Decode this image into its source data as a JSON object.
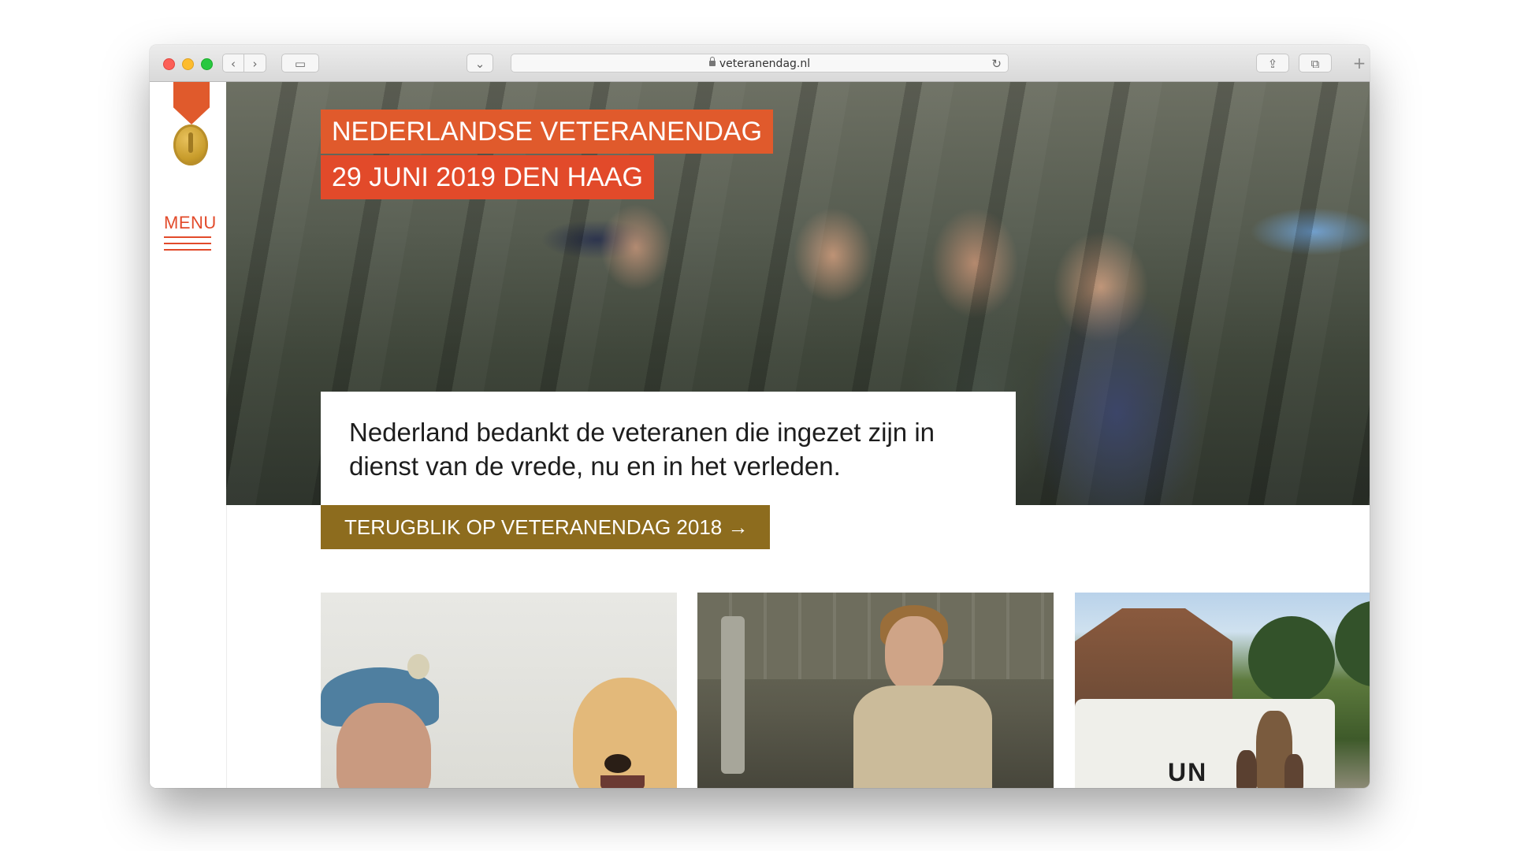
{
  "browser": {
    "url": "veteranendag.nl",
    "traffic_lights": [
      "close",
      "minimize",
      "zoom"
    ],
    "nav_back_icon": "‹",
    "nav_forward_icon": "›",
    "sidebar_icon": "▭",
    "pocket_icon": "⌄",
    "reload_icon": "↻",
    "share_icon": "⇪",
    "tabs_icon": "⧉",
    "new_tab_icon": "+"
  },
  "sidebar": {
    "menu_label": "MENU"
  },
  "hero": {
    "title": "NEDERLANDSE VETERANENDAG",
    "date_line": "29 JUNI 2019 DEN HAAG",
    "tagline": "Nederland bedankt de veteranen die ingezet zijn in dienst van de vrede, nu en in het verleden.",
    "cta_label": "TERUGBLIK OP VETERANENDAG 2018 →"
  },
  "cards": [
    {
      "name": "veteran-with-dog"
    },
    {
      "name": "female-soldier-aircraft"
    },
    {
      "name": "un-vehicle"
    }
  ],
  "card3": {
    "vehicle_text": "UN"
  },
  "colors": {
    "accent_orange": "#e05a2c",
    "accent_red": "#e24a2a",
    "cta_gold": "#8d6c1e"
  }
}
